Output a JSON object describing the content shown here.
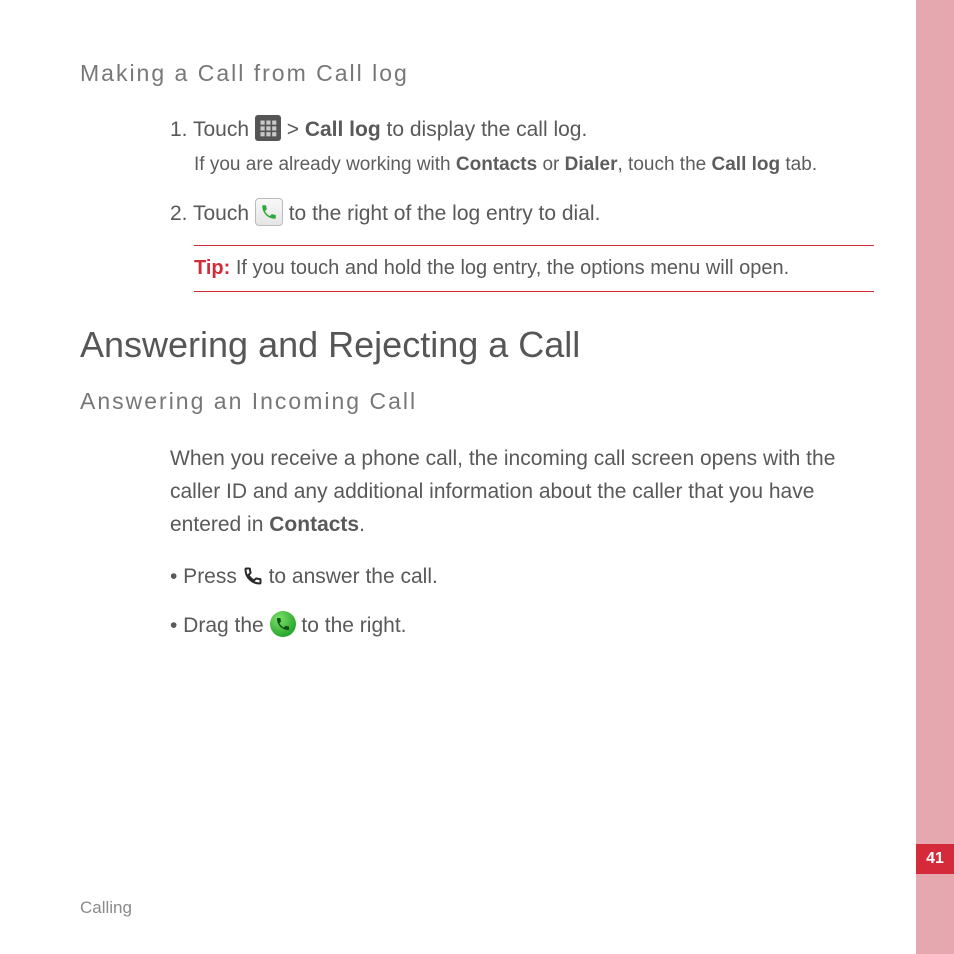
{
  "section1": {
    "title": "Making a Call from Call log",
    "step1": {
      "num": "1.",
      "pre": "Touch",
      "mid": ">",
      "bold1": "Call log",
      "post": "to display the call log.",
      "sub_pre": "If you are already working with",
      "sub_bold1": "Contacts",
      "sub_or": "or",
      "sub_bold2": "Dialer",
      "sub_mid": ", touch the",
      "sub_bold3": "Call log",
      "sub_post": "tab."
    },
    "step2": {
      "num": "2.",
      "pre": "Touch",
      "post": "to the right of the log entry to dial."
    },
    "tip": {
      "label": "Tip:",
      "text": "If you touch and hold the log entry, the options menu will open."
    }
  },
  "section2": {
    "title": "Answering and Rejecting a Call",
    "sub1": {
      "title": "Answering an Incoming Call",
      "para_pre": "When you receive a phone call, the incoming call screen opens with the caller ID and any additional information about the caller that you have entered in",
      "para_bold": "Contacts",
      "para_post": ".",
      "bullet1_pre": "• Press",
      "bullet1_post": "to answer the call.",
      "bullet2_pre": "• Drag the",
      "bullet2_post": "to the right."
    }
  },
  "footer": "Calling",
  "page_number": "41",
  "icons": {
    "apps": "apps-grid-icon",
    "call_btn": "call-button-icon",
    "phone": "phone-handset-icon",
    "answer": "answer-call-icon"
  }
}
